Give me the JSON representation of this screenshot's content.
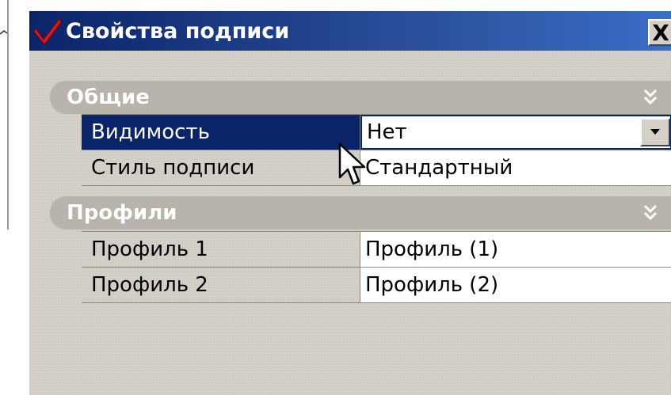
{
  "dialog": {
    "title": "Свойства подписи",
    "close_label": "X",
    "title_icon": "red-checkmark-icon",
    "colors": {
      "titlebar": "#0a246a",
      "background": "#d4d0c8",
      "selection": "#0a246a",
      "section_header": "#b8b4ab"
    }
  },
  "sections": [
    {
      "label": "Общие",
      "collapse_icon": "double-chevron-up-icon",
      "rows": [
        {
          "name": "Видимость",
          "value": "Нет",
          "selected": true,
          "has_dropdown": true
        },
        {
          "name": "Стиль подписи",
          "value": "Стандартный",
          "selected": false,
          "has_dropdown": false
        }
      ]
    },
    {
      "label": "Профили",
      "collapse_icon": "double-chevron-up-icon",
      "rows": [
        {
          "name": "Профиль 1",
          "value": "Профиль (1)",
          "selected": false,
          "has_dropdown": false
        },
        {
          "name": "Профиль 2",
          "value": "Профиль (2)",
          "selected": false,
          "has_dropdown": false
        }
      ]
    }
  ]
}
